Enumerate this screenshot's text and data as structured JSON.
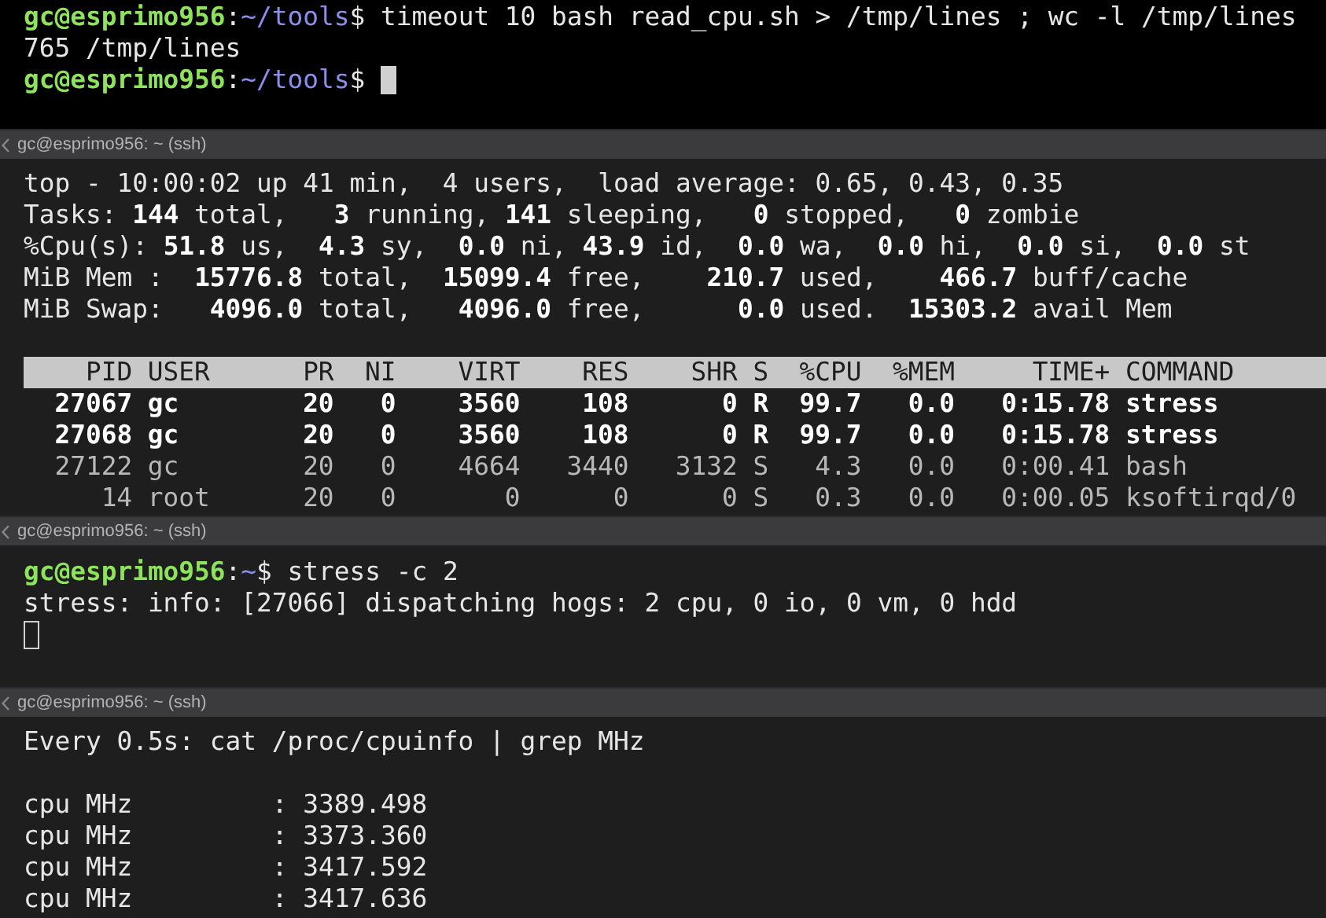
{
  "panes": [
    {
      "focused": true,
      "lines": [
        {
          "kind": "prompt",
          "user": "gc@esprimo956",
          "sep": ":",
          "path": "~/tools",
          "sigil": "$",
          "command": " timeout 10 bash read_cpu.sh > /tmp/lines ; wc -l /tmp/lines",
          "cursor": false
        },
        {
          "kind": "text",
          "text": "765 /tmp/lines"
        },
        {
          "kind": "prompt",
          "user": "gc@esprimo956",
          "sep": ":",
          "path": "~/tools",
          "sigil": "$",
          "cursor": true
        }
      ]
    },
    {
      "title": "gc@esprimo956: ~ (ssh)",
      "focused": false,
      "lines": [
        {
          "kind": "text",
          "text": "top - 10:00:02 up 41 min,  4 users,  load average: 0.65, 0.43, 0.35"
        },
        {
          "kind": "text",
          "text": "Tasks: **144** total,   **3** running, **141** sleeping,   **0** stopped,   **0** zombie"
        },
        {
          "kind": "text",
          "text": "%Cpu(s): **51.8** us,  **4.3** sy,  **0.0** ni, **43.9** id,  **0.0** wa,  **0.0** hi,  **0.0** si,  **0.0** st"
        },
        {
          "kind": "text",
          "text": "MiB Mem :  **15776.8** total,  **15099.4** free,    **210.7** used,    **466.7** buff/cache"
        },
        {
          "kind": "text",
          "text": "MiB Swap:   **4096.0** total,   **4096.0** free,      **0.0** used.  **15303.2** avail Mem"
        },
        {
          "kind": "blank"
        },
        {
          "kind": "table",
          "columns": [
            "PID",
            "USER",
            "PR",
            "NI",
            "VIRT",
            "RES",
            "SHR",
            "S",
            "%CPU",
            "%MEM",
            "TIME+",
            "COMMAND"
          ],
          "rows": [
            {
              "bold": true,
              "cells": [
                "27067",
                "gc",
                "20",
                "0",
                "3560",
                "108",
                "0",
                "R",
                "99.7",
                "0.0",
                "0:15.78",
                "stress"
              ]
            },
            {
              "bold": true,
              "cells": [
                "27068",
                "gc",
                "20",
                "0",
                "3560",
                "108",
                "0",
                "R",
                "99.7",
                "0.0",
                "0:15.78",
                "stress"
              ]
            },
            {
              "bold": false,
              "cells": [
                "27122",
                "gc",
                "20",
                "0",
                "4664",
                "3440",
                "3132",
                "S",
                "4.3",
                "0.0",
                "0:00.41",
                "bash"
              ]
            },
            {
              "bold": false,
              "cells": [
                "14",
                "root",
                "20",
                "0",
                "0",
                "0",
                "0",
                "S",
                "0.3",
                "0.0",
                "0:00.05",
                "ksoftirqd/0"
              ]
            }
          ]
        }
      ]
    },
    {
      "title": "gc@esprimo956: ~ (ssh)",
      "focused": false,
      "lines": [
        {
          "kind": "prompt",
          "user": "gc@esprimo956",
          "sep": ":",
          "path": "~",
          "sigil": "$",
          "command": " stress -c 2",
          "cursor": false
        },
        {
          "kind": "text",
          "text": "stress: info: [27066] dispatching hogs: 2 cpu, 0 io, 0 vm, 0 hdd"
        },
        {
          "kind": "cursor"
        }
      ]
    },
    {
      "title": "gc@esprimo956: ~ (ssh)",
      "focused": false,
      "lines": [
        {
          "kind": "text",
          "text": "Every 0.5s: cat /proc/cpuinfo | grep MHz"
        },
        {
          "kind": "blank"
        },
        {
          "kind": "text",
          "text": "cpu MHz         : 3389.498"
        },
        {
          "kind": "text",
          "text": "cpu MHz         : 3373.360"
        },
        {
          "kind": "text",
          "text": "cpu MHz         : 3417.592"
        },
        {
          "kind": "text",
          "text": "cpu MHz         : 3417.636"
        }
      ]
    }
  ]
}
